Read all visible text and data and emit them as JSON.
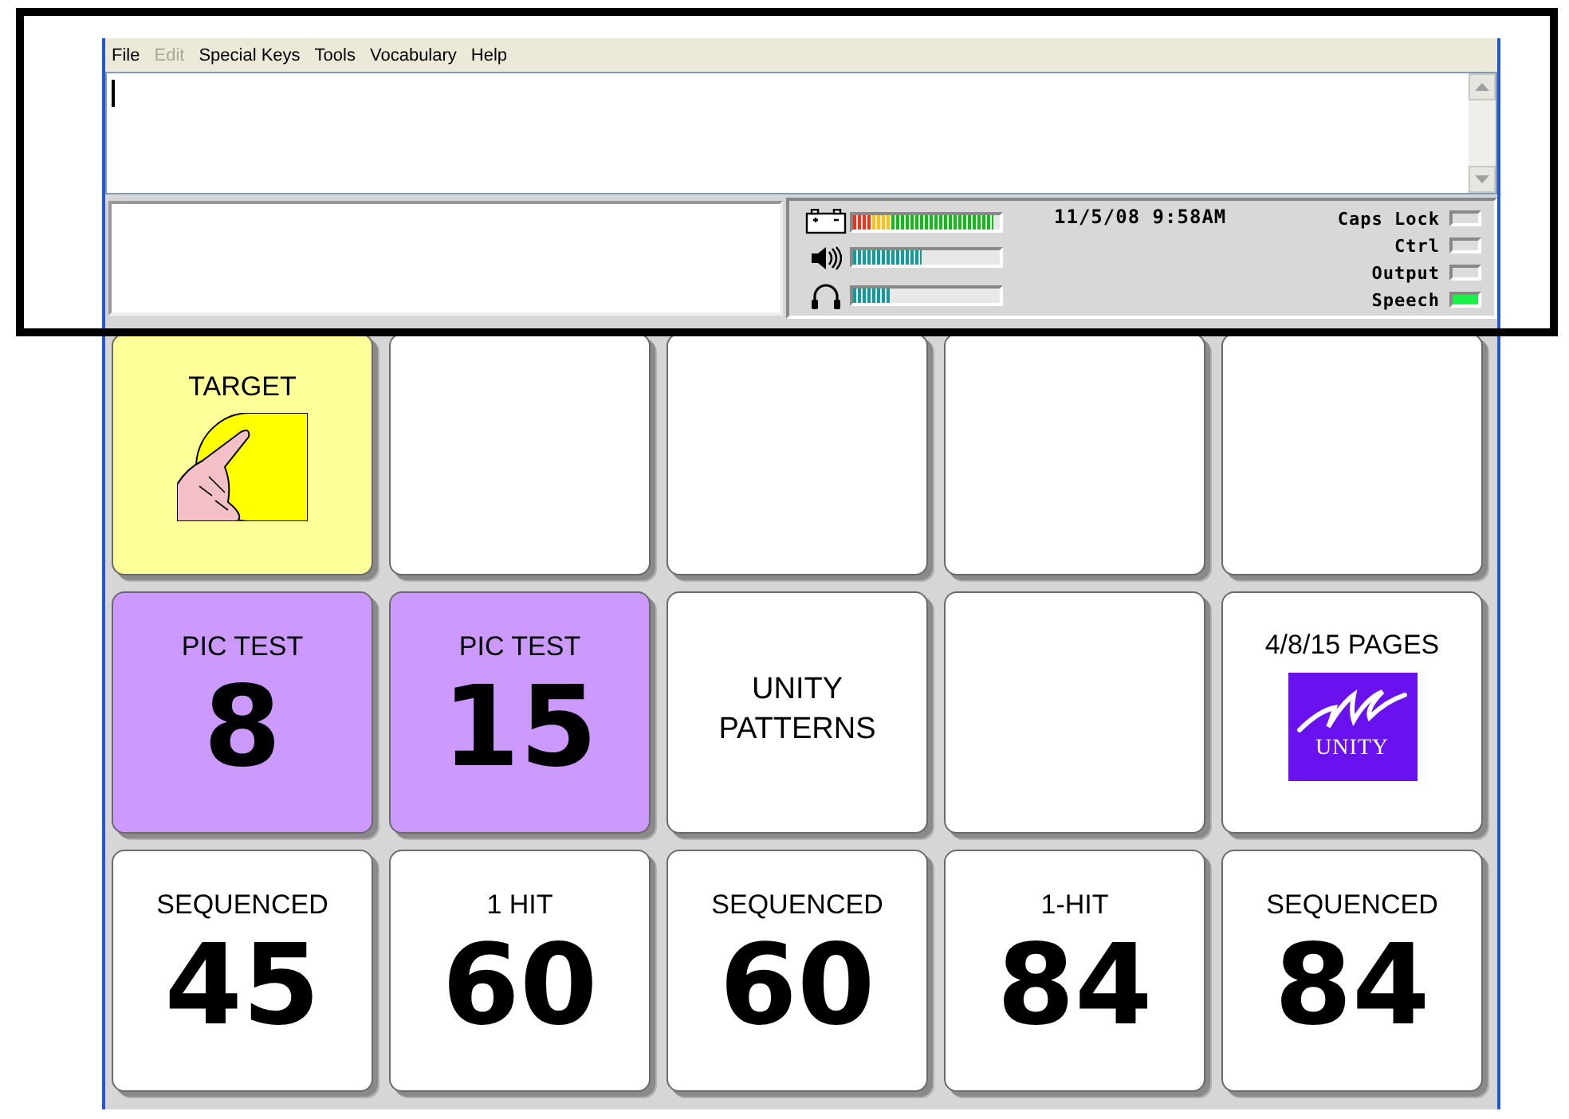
{
  "menu": [
    {
      "label": "File",
      "disabled": false
    },
    {
      "label": "Edit",
      "disabled": true
    },
    {
      "label": "Special Keys",
      "disabled": false
    },
    {
      "label": "Tools",
      "disabled": false
    },
    {
      "label": "Vocabulary",
      "disabled": false
    },
    {
      "label": "Help",
      "disabled": false
    }
  ],
  "status": {
    "meters": [
      {
        "kind": "battery",
        "level": 0.96
      },
      {
        "kind": "speaker",
        "level": 0.47
      },
      {
        "kind": "headphones",
        "level": 0.26
      }
    ],
    "datetime": "11/5/08 9:58AM",
    "indicators": [
      {
        "label": "Caps Lock",
        "on": false
      },
      {
        "label": "Ctrl",
        "on": false
      },
      {
        "label": "Output",
        "on": false
      },
      {
        "label": "Speech",
        "on": true
      }
    ]
  },
  "keys": [
    {
      "kind": "picture",
      "label": "TARGET",
      "color": "#ffff99"
    },
    {
      "kind": "blank",
      "color": "#ffffff"
    },
    {
      "kind": "blank",
      "color": "#ffffff"
    },
    {
      "kind": "blank",
      "color": "#ffffff"
    },
    {
      "kind": "blank",
      "color": "#ffffff"
    },
    {
      "kind": "number",
      "label": "PIC TEST",
      "number": "8",
      "color": "#cc99ff"
    },
    {
      "kind": "number",
      "label": "PIC TEST",
      "number": "15",
      "color": "#cc99ff"
    },
    {
      "kind": "text",
      "label": "UNITY PATTERNS",
      "color": "#ffffff"
    },
    {
      "kind": "blank",
      "color": "#ffffff"
    },
    {
      "kind": "logo",
      "label": "4/8/15 PAGES",
      "logo_text": "UNITY",
      "color": "#ffffff"
    },
    {
      "kind": "number",
      "label": "SEQUENCED",
      "number": "45",
      "color": "#ffffff"
    },
    {
      "kind": "number",
      "label": "1 HIT",
      "number": "60",
      "color": "#ffffff"
    },
    {
      "kind": "number",
      "label": "SEQUENCED",
      "number": "60",
      "color": "#ffffff"
    },
    {
      "kind": "number",
      "label": "1-HIT",
      "number": "84",
      "color": "#ffffff"
    },
    {
      "kind": "number",
      "label": "SEQUENCED",
      "number": "84",
      "color": "#ffffff"
    }
  ]
}
